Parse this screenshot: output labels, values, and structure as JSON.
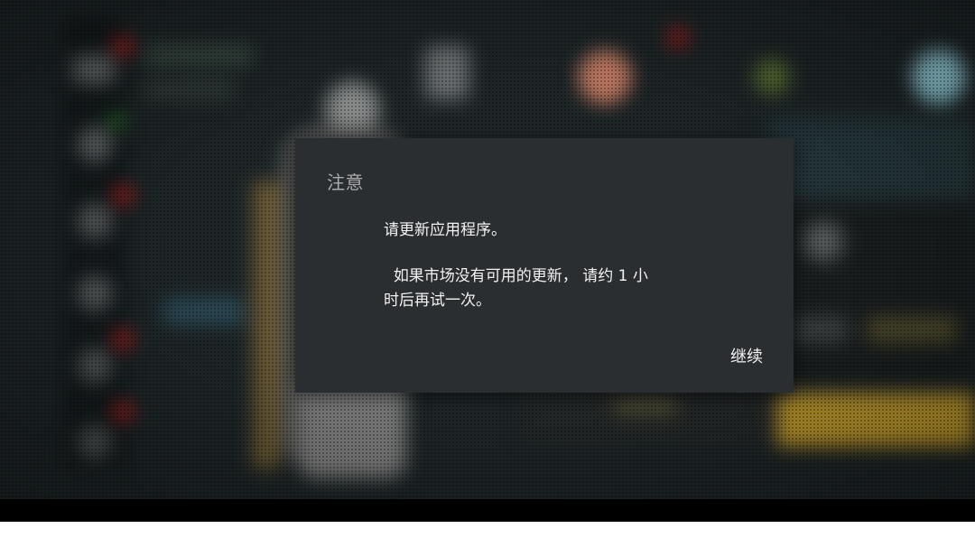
{
  "dialog": {
    "title": "注意",
    "message_line1": "请更新应用程序。",
    "message_line2": "  如果市场没有可用的更新， 请约 1 小时后再试一次。",
    "continue_label": "继续"
  },
  "colors": {
    "dialog_background": "#2b2e31",
    "title_text": "#a9abad",
    "body_text": "#f2f2f2",
    "navigation_bar": "#000000"
  }
}
